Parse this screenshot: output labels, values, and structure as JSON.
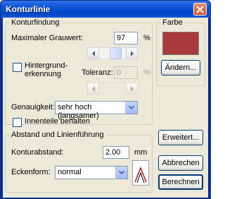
{
  "window": {
    "title": "Konturlinie"
  },
  "konturfindung": {
    "legend": "Konturfindung",
    "max_grauwert_label": "Maximaler Grauwert:",
    "max_grauwert_value": "97",
    "max_grauwert_unit": "%",
    "max_grauwert_slider_level": 0.8,
    "hintergrund_label_line1": "Hintergrund-",
    "hintergrund_label_line2": "erkennung",
    "hintergrund_checked": false,
    "toleranz_label": "Toleranz:",
    "toleranz_value": "0",
    "toleranz_unit": "%",
    "genauigkeit_label": "Genauigkeit:",
    "genauigkeit_value": "sehr hoch (langsamer)",
    "innenteile_label": "Innenteile behalten",
    "innenteile_checked": false
  },
  "abstand": {
    "legend": "Abstand und Linienführung",
    "konturabstand_label": "Konturabstand:",
    "konturabstand_value": "2.00",
    "konturabstand_unit": "mm",
    "eckenform_label": "Eckenform:",
    "eckenform_value": "normal"
  },
  "farbe": {
    "legend": "Farbe",
    "swatch_color": "#a83a3b",
    "aendern_label": "Ändern..."
  },
  "buttons": {
    "erweitert": "Erweitert...",
    "abbrechen": "Abbrechen",
    "berechnen": "Berechnen"
  }
}
